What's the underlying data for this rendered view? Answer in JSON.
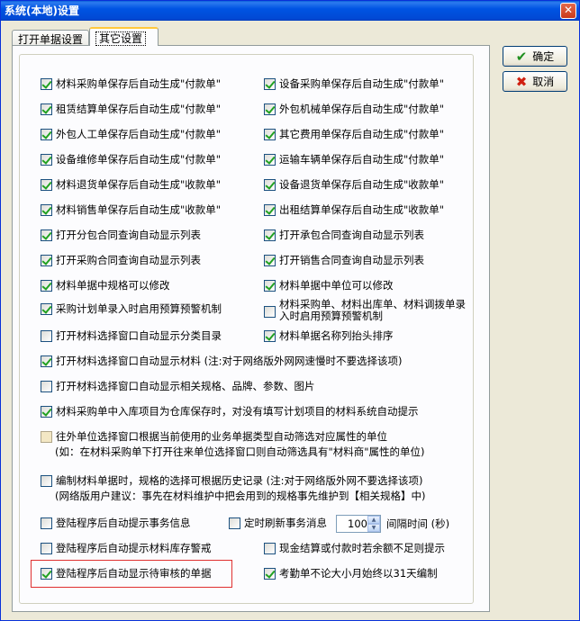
{
  "window": {
    "title": "系统(本地)设置",
    "close": "✕"
  },
  "tabs": [
    "打开单据设置",
    "其它设置"
  ],
  "buttons": {
    "ok": "确定",
    "cancel": "取消"
  },
  "options": [
    {
      "label": "材料采购单保存后自动生成\"付款单\"",
      "checked": true
    },
    {
      "label": "设备采购单保存后自动生成\"付款单\"",
      "checked": true
    },
    {
      "label": "租赁结算单保存后自动生成\"付款单\"",
      "checked": true
    },
    {
      "label": "外包机械单保存后自动生成\"付款单\"",
      "checked": true
    },
    {
      "label": "外包人工单保存后自动生成\"付款单\"",
      "checked": true
    },
    {
      "label": "其它费用单保存后自动生成\"付款单\"",
      "checked": true
    },
    {
      "label": "设备维修单保存后自动生成\"付款单\"",
      "checked": true
    },
    {
      "label": "运输车辆单保存后自动生成\"付款单\"",
      "checked": true
    },
    {
      "label": "材料退货单保存后自动生成\"收款单\"",
      "checked": true
    },
    {
      "label": "设备退货单保存后自动生成\"收款单\"",
      "checked": true
    },
    {
      "label": "材料销售单保存后自动生成\"收款单\"",
      "checked": true
    },
    {
      "label": "出租结算单保存后自动生成\"收款单\"",
      "checked": true
    },
    {
      "label": "打开分包合同查询自动显示列表",
      "checked": true
    },
    {
      "label": "打开承包合同查询自动显示列表",
      "checked": true
    },
    {
      "label": "打开采购合同查询自动显示列表",
      "checked": true
    },
    {
      "label": "打开销售合同查询自动显示列表",
      "checked": true
    },
    {
      "label": "材料单据中规格可以修改",
      "checked": true
    },
    {
      "label": "材料单据中单位可以修改",
      "checked": true
    },
    {
      "label": "采购计划单录入时启用预算预警机制",
      "checked": true
    },
    {
      "label": "材料采购单、材料出库单、材料调拨单录入时启用预算预警机制",
      "checked": false
    },
    {
      "label": "打开材料选择窗口自动显示分类目录",
      "checked": false
    },
    {
      "label": "材料单据名称列抬头排序",
      "checked": true
    },
    {
      "label": "打开材料选择窗口自动显示材料 (注:对于网络版外网网速慢时不要选择该项)",
      "checked": true
    },
    {
      "label": "打开材料选择窗口自动显示相关规格、品牌、参数、图片",
      "checked": false
    },
    {
      "label": "材料采购单中入库项目为仓库保存时，对没有填写计划项目的材料系统自动提示",
      "checked": true
    },
    {
      "label": "往外单位选择窗口根据当前使用的业务单据类型自动筛选对应属性的单位",
      "sub": "(如：在材料采购单下打开往来单位选择窗口则自动筛选具有\"材料商\"属性的单位)",
      "checked": false
    },
    {
      "label": "编制材料单据时，规格的选择可根据历史记录 (注:对于网络版外网不要选择该项)",
      "sub": "(网络版用户建议：事先在材料维护中把会用到的规格事先维护到【相关规格】中)",
      "checked": false
    },
    {
      "label": "登陆程序后自动提示事务信息",
      "checked": false
    },
    {
      "label": "定时刷新事务消息",
      "checked": false
    },
    {
      "label": "登陆程序后自动提示材料库存警戒",
      "checked": false
    },
    {
      "label": "现金结算或付款时若余额不足则提示",
      "checked": false
    },
    {
      "label": "登陆程序后自动显示待审核的单据",
      "checked": true
    },
    {
      "label": "考勤单不论大小月始终以31天编制",
      "checked": true
    }
  ],
  "refresh": {
    "value": "100",
    "label": "间隔时间 (秒)"
  }
}
